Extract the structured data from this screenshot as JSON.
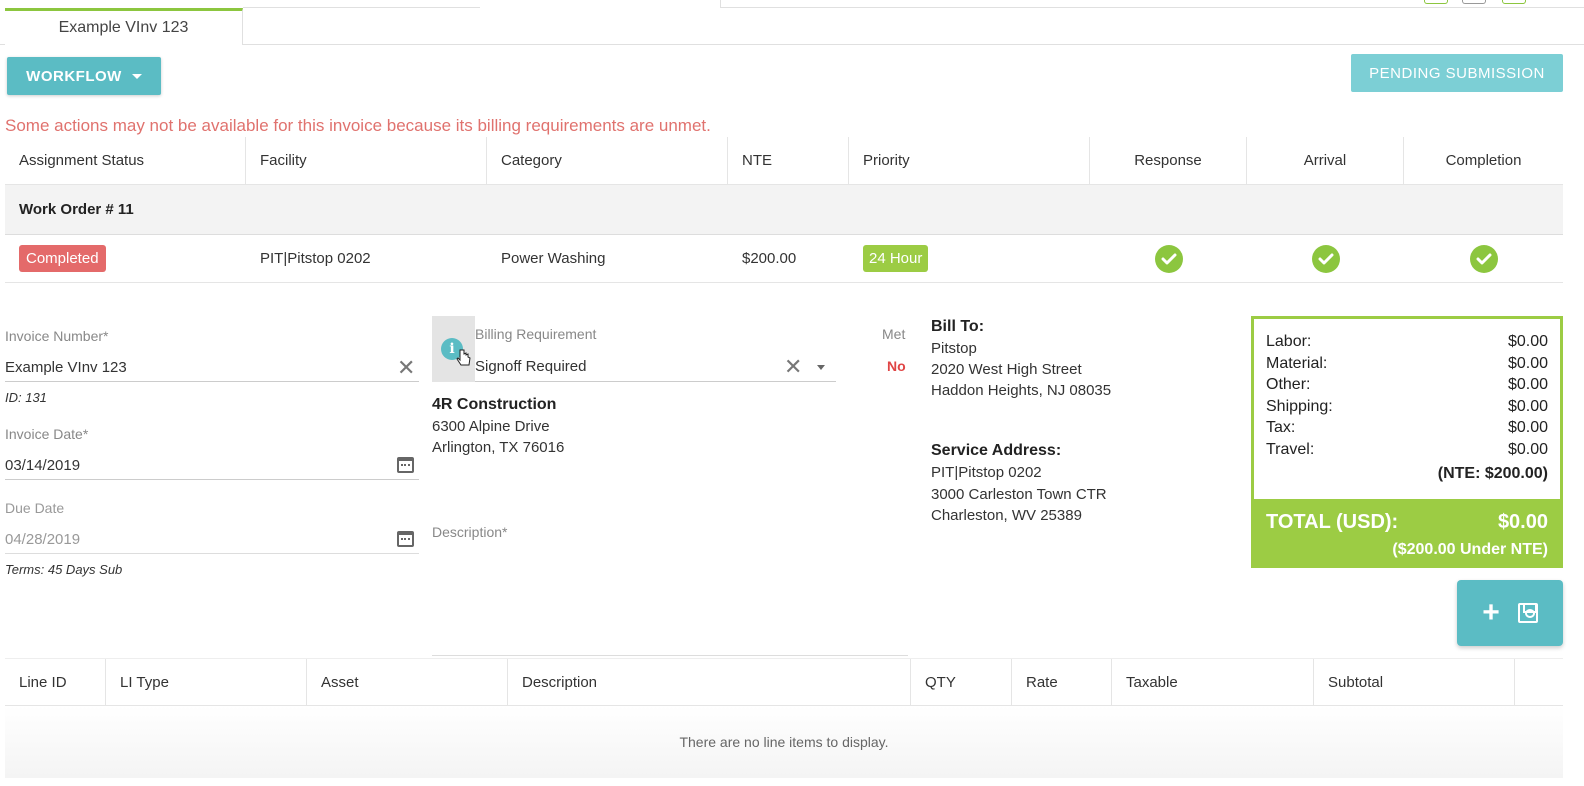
{
  "tab": {
    "label": "Example VInv 123"
  },
  "toolbar": {
    "workflow_label": "WORKFLOW",
    "pending_label": "PENDING SUBMISSION"
  },
  "warning": "Some actions may not be available for this invoice because its billing requirements are unmet.",
  "work_order_table": {
    "headers": [
      "Assignment Status",
      "Facility",
      "Category",
      "NTE",
      "Priority",
      "Response",
      "Arrival",
      "Completion"
    ],
    "group_label": "Work Order # 11",
    "row": {
      "status": "Completed",
      "facility": "PIT|Pitstop 0202",
      "category": "Power Washing",
      "nte": "$200.00",
      "priority": "24 Hour",
      "response": "check",
      "arrival": "check",
      "completion": "check"
    }
  },
  "form": {
    "invoice_number_label": "Invoice Number*",
    "invoice_number_value": "Example VInv 123",
    "id_text": "ID: 131",
    "invoice_date_label": "Invoice Date*",
    "invoice_date_value": "03/14/2019",
    "due_date_label": "Due Date",
    "due_date_value": "04/28/2019",
    "terms_text": "Terms: 45 Days Sub",
    "billing_req_label": "Billing Requirement",
    "billing_req_value": "Signoff Required",
    "met_label": "Met",
    "met_value": "No",
    "vendor_name": "4R Construction",
    "vendor_addr1": "6300 Alpine Drive",
    "vendor_addr2": "Arlington, TX 76016",
    "description_label": "Description*"
  },
  "bill_to": {
    "label": "Bill To:",
    "name": "Pitstop",
    "addr1": "2020 West High Street",
    "addr2": "Haddon Heights, NJ 08035"
  },
  "service_address": {
    "label": "Service Address:",
    "name": "PIT|Pitstop 0202",
    "addr1": "3000 Carleston Town CTR",
    "addr2": "Charleston, WV 25389"
  },
  "totals": {
    "rows": [
      {
        "label": "Labor:",
        "value": "$0.00"
      },
      {
        "label": "Material:",
        "value": "$0.00"
      },
      {
        "label": "Other:",
        "value": "$0.00"
      },
      {
        "label": "Shipping:",
        "value": "$0.00"
      },
      {
        "label": "Tax:",
        "value": "$0.00"
      },
      {
        "label": "Travel:",
        "value": "$0.00"
      }
    ],
    "nte": "(NTE: $200.00)",
    "total_label": "TOTAL (USD):",
    "total_value": "$0.00",
    "under_nte": "($200.00 Under NTE)"
  },
  "line_items": {
    "headers": [
      "Line ID",
      "LI Type",
      "Asset",
      "Description",
      "QTY",
      "Rate",
      "Taxable",
      "Subtotal",
      ""
    ],
    "empty_text": "There are no line items to display."
  },
  "colors": {
    "accent": "#5bbcc4",
    "green": "#9ccc44",
    "danger": "#e46a6a",
    "warning_text": "#e0726e"
  }
}
